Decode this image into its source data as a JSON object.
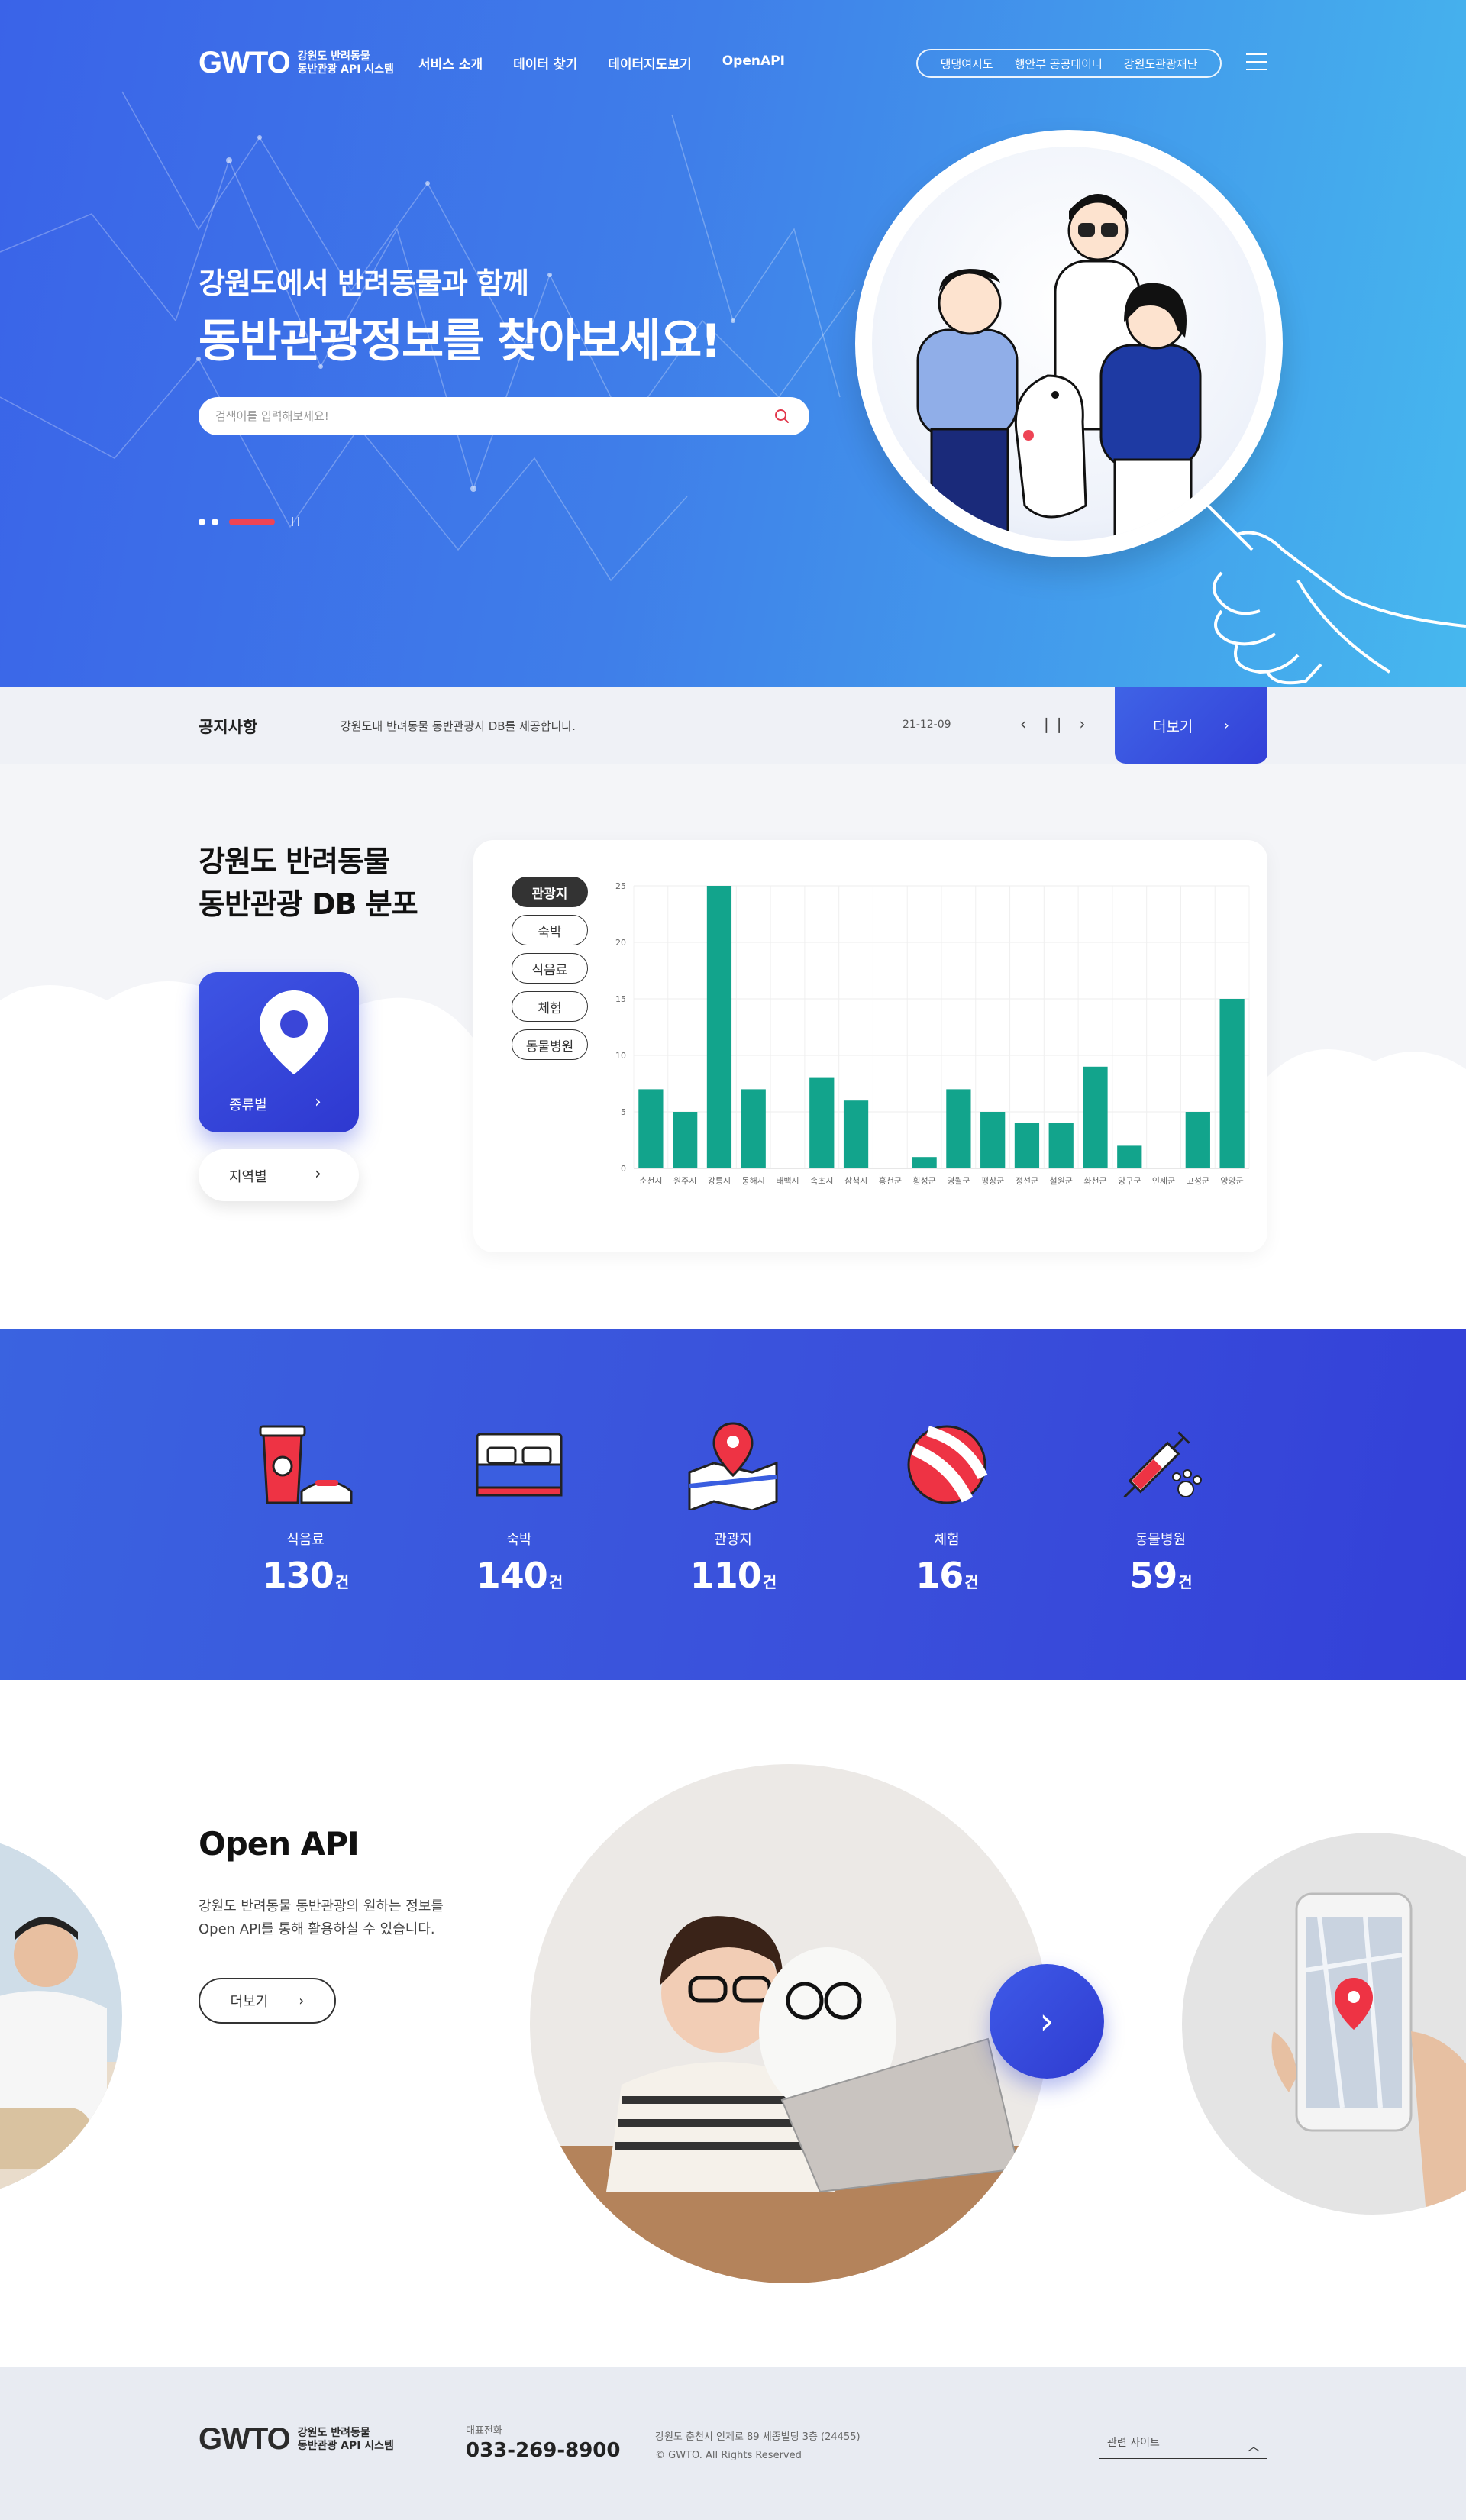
{
  "header": {
    "logo_mark": "GWTO",
    "logo_text": "강원도 반려동물\n동반관광 API 시스템",
    "nav": [
      "서비스 소개",
      "데이터 찾기",
      "데이터지도보기",
      "OpenAPI"
    ],
    "util_links": [
      "댕댕여지도",
      "행안부 공공데이터",
      "강원도관광재단"
    ]
  },
  "hero": {
    "title_line1": "강원도에서 반려동물과 함께",
    "title_line2": "동반관광정보를 찾아보세요!",
    "search_placeholder": "검색어를 입력해보세요!"
  },
  "notice": {
    "title": "공지사항",
    "text": "강원도내 반려동물 동반관광지 DB를 제공합니다.",
    "date": "21-12-09",
    "more_label": "더보기"
  },
  "distribution": {
    "title_line1": "강원도 반려동물",
    "title_line2": "동반관광 DB 분포",
    "type_label": "종류별",
    "region_label": "지역별",
    "tabs": [
      "관광지",
      "숙박",
      "식음료",
      "체험",
      "동물병원"
    ],
    "active_tab": "관광지"
  },
  "chart_data": {
    "type": "bar",
    "categories": [
      "춘천시",
      "원주시",
      "강릉시",
      "동해시",
      "태백시",
      "속초시",
      "삼척시",
      "홍천군",
      "횡성군",
      "영월군",
      "평창군",
      "정선군",
      "철원군",
      "화천군",
      "양구군",
      "인제군",
      "고성군",
      "양양군"
    ],
    "values": [
      7,
      5,
      25,
      7,
      0,
      8,
      6,
      0,
      1,
      7,
      5,
      4,
      4,
      9,
      2,
      0,
      5,
      15
    ],
    "ylim": [
      0,
      25
    ],
    "yticks": [
      0,
      5,
      10,
      15,
      20,
      25
    ],
    "grid": true,
    "bar_color": "#12a48c",
    "title": "",
    "xlabel": "",
    "ylabel": ""
  },
  "stats": [
    {
      "label": "식음료",
      "value": "130",
      "unit": "건",
      "icon": "food-drink-icon"
    },
    {
      "label": "숙박",
      "value": "140",
      "unit": "건",
      "icon": "bed-icon"
    },
    {
      "label": "관광지",
      "value": "110",
      "unit": "건",
      "icon": "map-pin-icon"
    },
    {
      "label": "체험",
      "value": "16",
      "unit": "건",
      "icon": "ball-icon"
    },
    {
      "label": "동물병원",
      "value": "59",
      "unit": "건",
      "icon": "syringe-paw-icon"
    }
  ],
  "openapi": {
    "title": "Open API",
    "desc_line1": "강원도 반려동물 동반관광의 원하는 정보를",
    "desc_line2": "Open API를 통해 활용하실 수 있습니다.",
    "more_label": "더보기"
  },
  "footer": {
    "logo_mark": "GWTO",
    "logo_text": "강원도 반려동물\n동반관광 API 시스템",
    "tel_label": "대표전화",
    "tel": "033-269-8900",
    "address": "강원도 춘천시 인제로 89 세종빌딩 3층 (24455)",
    "copyright": "© GWTO. All Rights Reserved",
    "related_label": "관련 사이트"
  },
  "colors": {
    "primary_blue": "#3a50dc",
    "accent_red": "#ee4455",
    "chart_green": "#12a48c"
  }
}
